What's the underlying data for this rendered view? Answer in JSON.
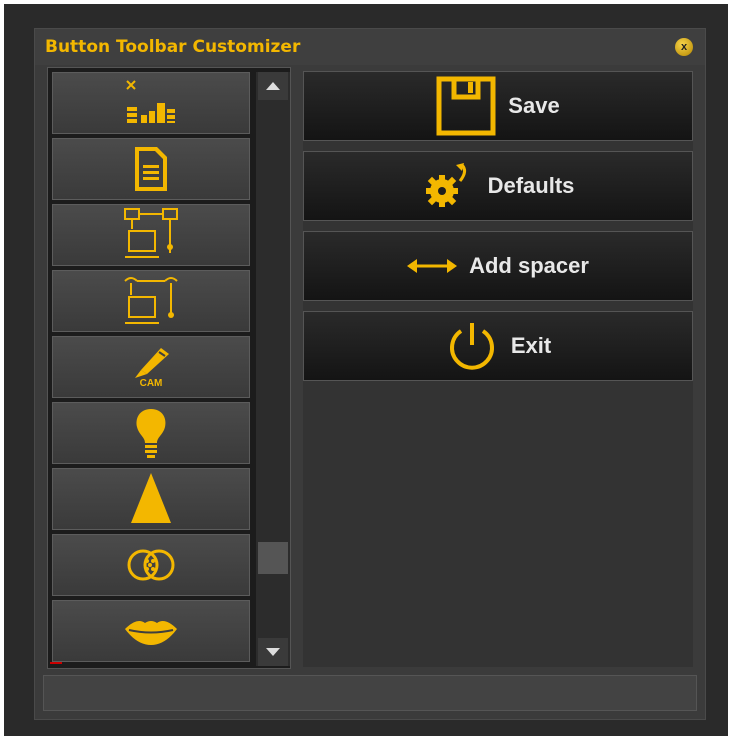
{
  "window": {
    "title": "Button Toolbar Customizer",
    "close_glyph": "x"
  },
  "toolbar_items": [
    {
      "icon": "layout-arrange-icon"
    },
    {
      "icon": "document-icon"
    },
    {
      "icon": "network-computers-icon"
    },
    {
      "icon": "network-sync-icon"
    },
    {
      "icon": "cam-tool-icon",
      "label": "CAM"
    },
    {
      "icon": "light-bulb-icon"
    },
    {
      "icon": "cone-icon"
    },
    {
      "icon": "overlapping-circles-icon"
    },
    {
      "icon": "lips-icon"
    }
  ],
  "actions": {
    "save": "Save",
    "defaults": "Defaults",
    "add_spacer": "Add spacer",
    "exit": "Exit"
  },
  "colors": {
    "accent": "#f3b700",
    "background": "#3b3b3b"
  }
}
